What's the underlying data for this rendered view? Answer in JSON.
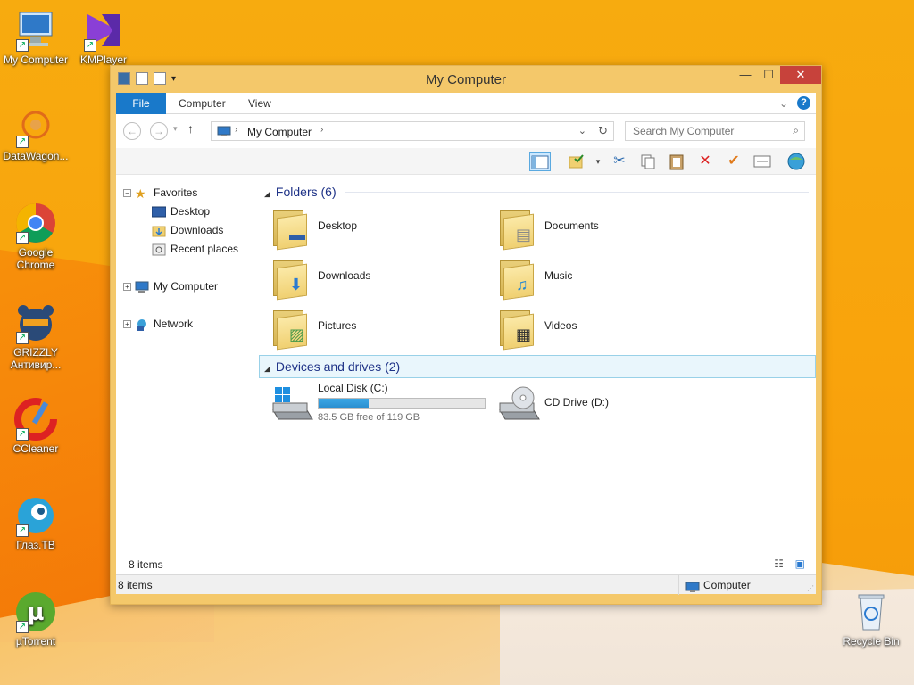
{
  "desktop": {
    "icons": [
      {
        "label": "My Computer",
        "icon": "my-computer-icon"
      },
      {
        "label": "KMPlayer",
        "icon": "kmplayer-icon"
      },
      {
        "label": "DataWagon...",
        "icon": "datawagon-icon"
      },
      {
        "label": "Google Chrome",
        "icon": "chrome-icon"
      },
      {
        "label": "GRIZZLY Антивир...",
        "icon": "grizzly-icon"
      },
      {
        "label": "CCleaner",
        "icon": "ccleaner-icon"
      },
      {
        "label": "Глаз.ТВ",
        "icon": "glaz-tv-icon"
      },
      {
        "label": "µTorrent",
        "icon": "utorrent-icon"
      },
      {
        "label": "Recycle Bin",
        "icon": "recycle-bin-icon"
      }
    ]
  },
  "window": {
    "title": "My Computer",
    "colors": {
      "accent": "#1979ca",
      "frame": "#f4c86a",
      "close": "#c7423b",
      "drive_fill": "#2a8fd0"
    }
  },
  "ribbon": {
    "tabs": [
      {
        "label": "File"
      },
      {
        "label": "Computer"
      },
      {
        "label": "View"
      }
    ]
  },
  "nav": {
    "address_crumb": "My Computer",
    "search_placeholder": "Search My Computer"
  },
  "navpane": {
    "favorites_label": "Favorites",
    "favorites_children": [
      {
        "label": "Desktop"
      },
      {
        "label": "Downloads"
      },
      {
        "label": "Recent places"
      }
    ],
    "computer_label": "My Computer",
    "network_label": "Network"
  },
  "content": {
    "folders_header": "Folders (6)",
    "folders": [
      {
        "label": "Desktop"
      },
      {
        "label": "Documents"
      },
      {
        "label": "Downloads"
      },
      {
        "label": "Music"
      },
      {
        "label": "Pictures"
      },
      {
        "label": "Videos"
      }
    ],
    "devices_header": "Devices and drives (2)",
    "drives": [
      {
        "label": "Local Disk (C:)",
        "free_text": "83.5 GB free of 119 GB",
        "used_fraction": 0.3
      },
      {
        "label": "CD Drive (D:)"
      }
    ]
  },
  "details": {
    "count": "8 items"
  },
  "status": {
    "count": "8 items",
    "location": "Computer"
  }
}
